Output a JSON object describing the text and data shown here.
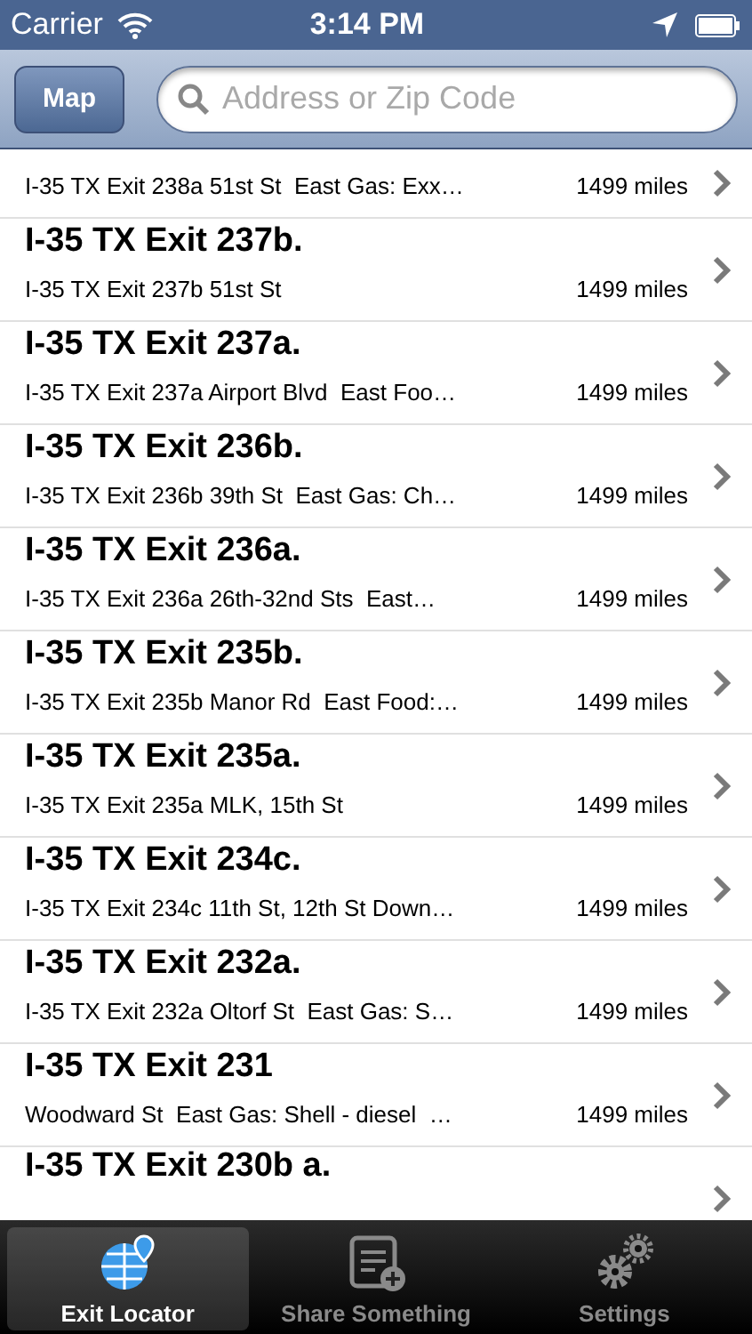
{
  "status_bar": {
    "carrier": "Carrier",
    "time": "3:14 PM"
  },
  "nav": {
    "map_button": "Map",
    "search": {
      "placeholder": "Address or Zip Code"
    }
  },
  "rows": [
    {
      "subtitle": "I-35 TX Exit 238a 51st St  East Gas: Exx…",
      "distance": "1499 miles"
    },
    {
      "title": "I-35 TX Exit 237b.",
      "subtitle": "I-35 TX Exit 237b 51st St",
      "distance": "1499 miles"
    },
    {
      "title": "I-35 TX Exit 237a.",
      "subtitle": "I-35 TX Exit 237a Airport Blvd  East Foo…",
      "distance": "1499 miles"
    },
    {
      "title": "I-35 TX Exit 236b.",
      "subtitle": "I-35 TX Exit 236b 39th St  East Gas: Ch…",
      "distance": "1499 miles"
    },
    {
      "title": "I-35 TX Exit 236a.",
      "subtitle": "I-35 TX Exit 236a 26th-32nd Sts  East…",
      "distance": "1499 miles"
    },
    {
      "title": "I-35 TX Exit 235b.",
      "subtitle": "I-35 TX Exit 235b Manor Rd  East Food:…",
      "distance": "1499 miles"
    },
    {
      "title": "I-35 TX Exit 235a.",
      "subtitle": "I-35 TX Exit 235a MLK, 15th St",
      "distance": "1499 miles"
    },
    {
      "title": "I-35 TX Exit 234c.",
      "subtitle": "I-35 TX Exit 234c 11th St, 12th St Down…",
      "distance": "1499 miles"
    },
    {
      "title": "I-35 TX Exit 232a.",
      "subtitle": "I-35 TX Exit 232a Oltorf St  East Gas: S…",
      "distance": "1499 miles"
    },
    {
      "title": "I-35 TX Exit 231",
      "subtitle": "Woodward St  East Gas: Shell - diesel  …",
      "distance": "1499 miles"
    },
    {
      "title": "I-35 TX Exit 230b a."
    }
  ],
  "tabs": [
    {
      "label": "Exit Locator",
      "kind": "globe",
      "selected": true
    },
    {
      "label": "Share Something",
      "kind": "share",
      "selected": false
    },
    {
      "label": "Settings",
      "kind": "gears",
      "selected": false
    }
  ]
}
